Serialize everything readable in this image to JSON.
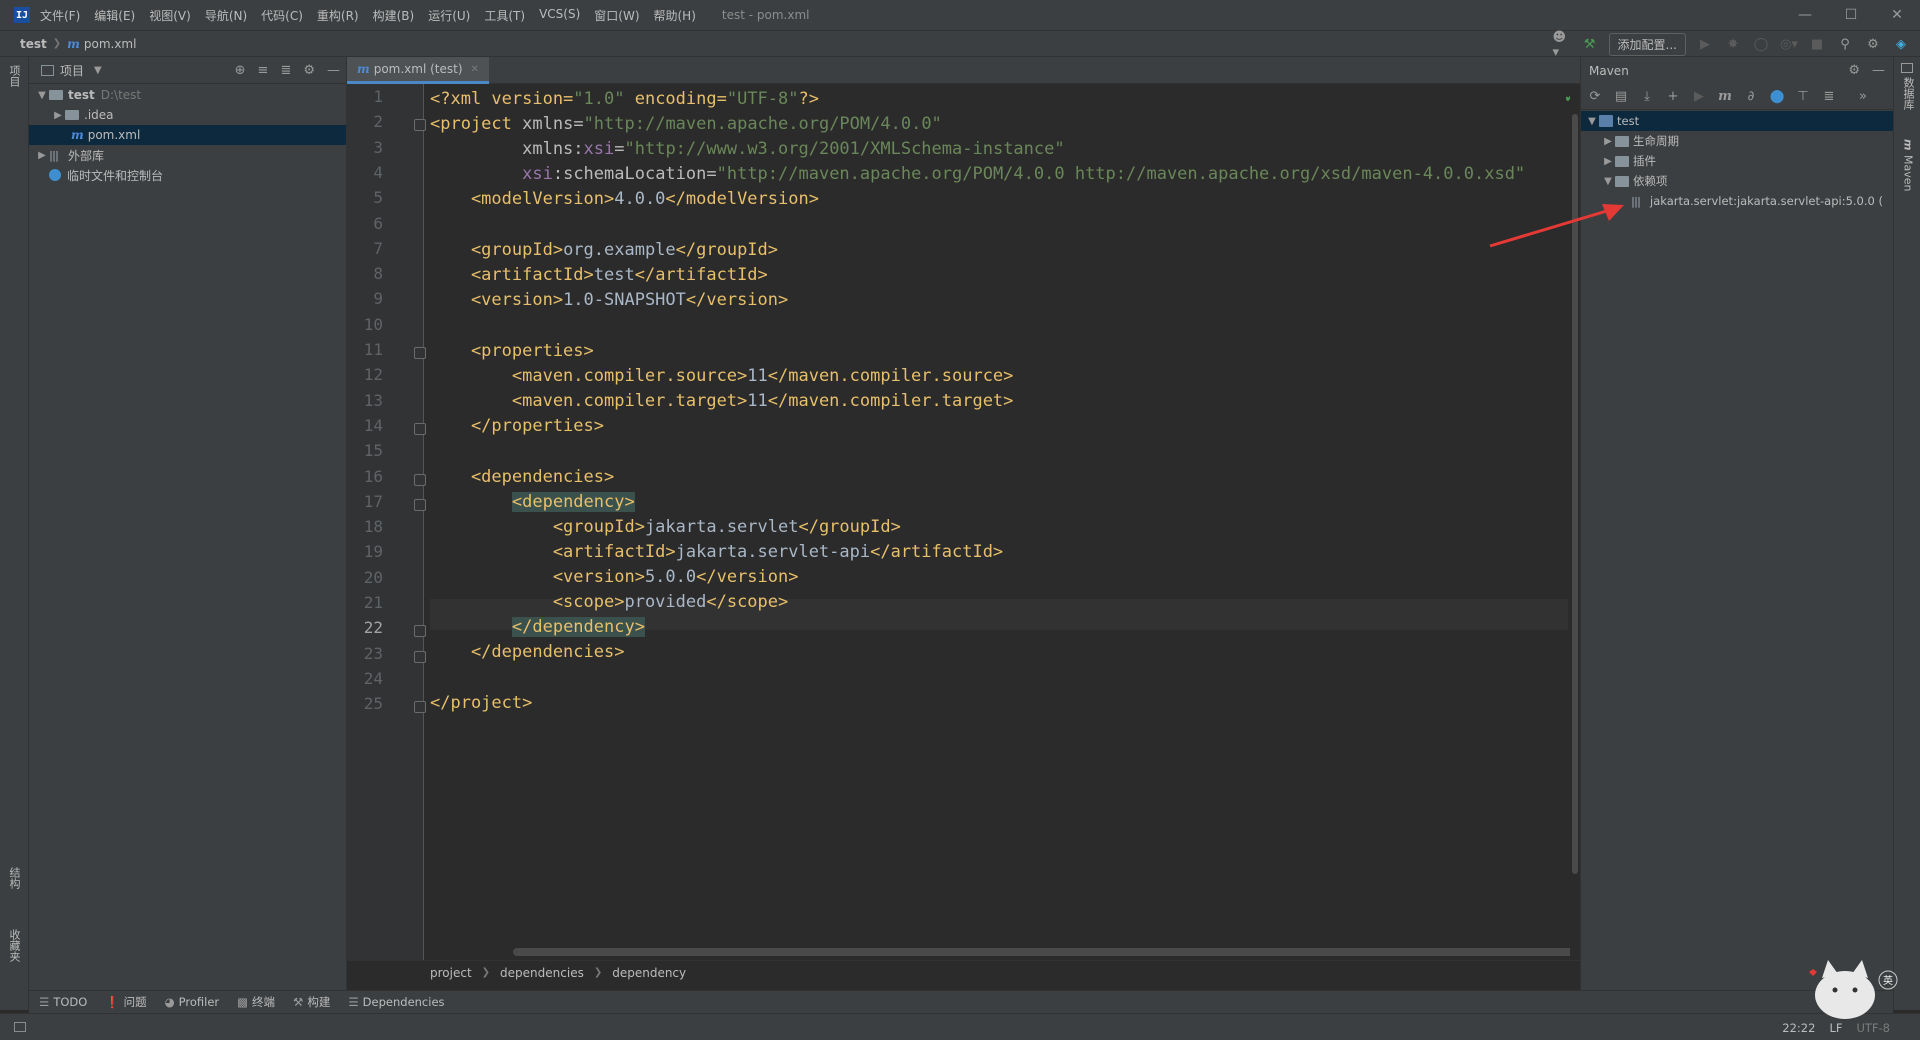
{
  "titlebar": {
    "menus": [
      "文件(F)",
      "编辑(E)",
      "视图(V)",
      "导航(N)",
      "代码(C)",
      "重构(R)",
      "构建(B)",
      "运行(U)",
      "工具(T)",
      "VCS(S)",
      "窗口(W)",
      "帮助(H)"
    ],
    "title": "test - pom.xml"
  },
  "navbar": {
    "project": "test",
    "file": "pom.xml",
    "add_config": "添加配置..."
  },
  "left_strip": {
    "project_tab": "项目",
    "structure_tab": "结构",
    "favorites_tab": "收藏夹"
  },
  "project_panel": {
    "header": "项目",
    "tree": {
      "root_name": "test",
      "root_path": "D:\\test",
      "idea": ".idea",
      "pom": "pom.xml",
      "external_libs": "外部库",
      "scratches": "临时文件和控制台"
    }
  },
  "editor": {
    "tab_label": "pom.xml (test)",
    "current_line": 22,
    "line_numbers": [
      "1",
      "2",
      "3",
      "4",
      "5",
      "6",
      "7",
      "8",
      "9",
      "10",
      "11",
      "12",
      "13",
      "14",
      "15",
      "16",
      "17",
      "18",
      "19",
      "20",
      "21",
      "22",
      "23",
      "24",
      "25"
    ]
  },
  "code": {
    "l1": {
      "a": "<?xml version=",
      "b": "\"1.0\"",
      "c": " encoding=",
      "d": "\"UTF-8\"",
      "e": "?>"
    },
    "l2": {
      "a": "<project ",
      "b": "xmlns",
      "c": "=",
      "d": "\"http://maven.apache.org/POM/4.0.0\""
    },
    "l3": {
      "a": "         xmlns:",
      "b": "xsi",
      "c": "=",
      "d": "\"http://www.w3.org/2001/XMLSchema-instance\""
    },
    "l4": {
      "a": "         ",
      "b": "xsi",
      "c": ":schemaLocation=",
      "d": "\"http://maven.apache.org/POM/4.0.0 http://maven.apache.org/xsd/maven-4.0.0.xsd\""
    },
    "l5": {
      "a": "    <modelVersion>",
      "b": "4.0.0",
      "c": "</modelVersion>"
    },
    "l7": {
      "a": "    <groupId>",
      "b": "org.example",
      "c": "</groupId>"
    },
    "l8": {
      "a": "    <artifactId>",
      "b": "test",
      "c": "</artifactId>"
    },
    "l9": {
      "a": "    <version>",
      "b": "1.0-SNAPSHOT",
      "c": "</version>"
    },
    "l11": "    <properties>",
    "l12": {
      "a": "        <maven.compiler.source>",
      "b": "11",
      "c": "</maven.compiler.source>"
    },
    "l13": {
      "a": "        <maven.compiler.target>",
      "b": "11",
      "c": "</maven.compiler.target>"
    },
    "l14": "    </properties>",
    "l16": "    <dependencies>",
    "l17": "<dependency>",
    "l18": {
      "a": "            <groupId>",
      "b": "jakarta.servlet",
      "c": "</groupId>"
    },
    "l19": {
      "a": "            <artifactId>",
      "b": "jakarta.servlet-api",
      "c": "</artifactId>"
    },
    "l20": {
      "a": "            <version>",
      "b": "5.0.0",
      "c": "</version>"
    },
    "l21": {
      "a": "            <scope>",
      "b": "provided",
      "c": "</scope>"
    },
    "l22": "</dependency>",
    "l23": "    </dependencies>",
    "l25": "</project>"
  },
  "breadcrumb": [
    "project",
    "dependencies",
    "dependency"
  ],
  "maven": {
    "title": "Maven",
    "root": "test",
    "lifecycle": "生命周期",
    "plugins": "插件",
    "dependencies": "依赖项",
    "dep_item": "jakarta.servlet:jakarta.servlet-api:5.0.0 ("
  },
  "right_strip": {
    "database_tab": "数据库",
    "maven_tab": "Maven"
  },
  "bottom_tools": {
    "todo": "TODO",
    "problems": "问题",
    "profiler": "Profiler",
    "terminal": "终端",
    "build": "构建",
    "dependencies": "Dependencies"
  },
  "status": {
    "position": "22:22",
    "line_sep": "LF",
    "encoding": "UTF-8",
    "ime": "英"
  },
  "colors": {
    "accent": "#4a88c7",
    "arrow": "#e53935",
    "selection": "#0d293e"
  }
}
